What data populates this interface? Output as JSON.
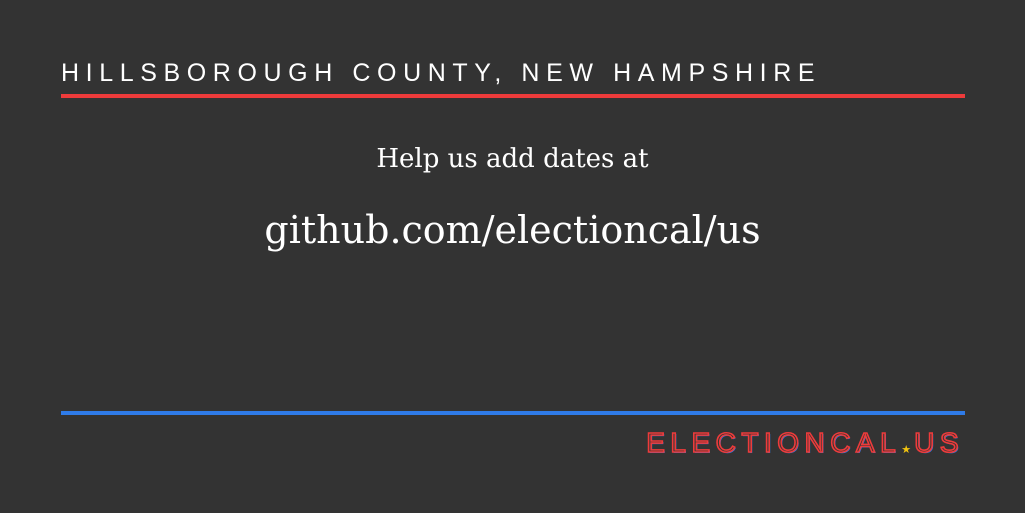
{
  "header": {
    "title": "HILLSBOROUGH COUNTY, NEW HAMPSHIRE"
  },
  "body": {
    "help_text": "Help us add dates at",
    "repo_url": "github.com/electioncal/us"
  },
  "logo": {
    "part1": "ELECTIONCAL",
    "part2": "US",
    "separator_icon": "star-icon"
  },
  "colors": {
    "background": "#333333",
    "text": "#ffffff",
    "accent_red": "#ee3b3b",
    "accent_blue": "#2f7be8",
    "star": "#f2c40f"
  }
}
